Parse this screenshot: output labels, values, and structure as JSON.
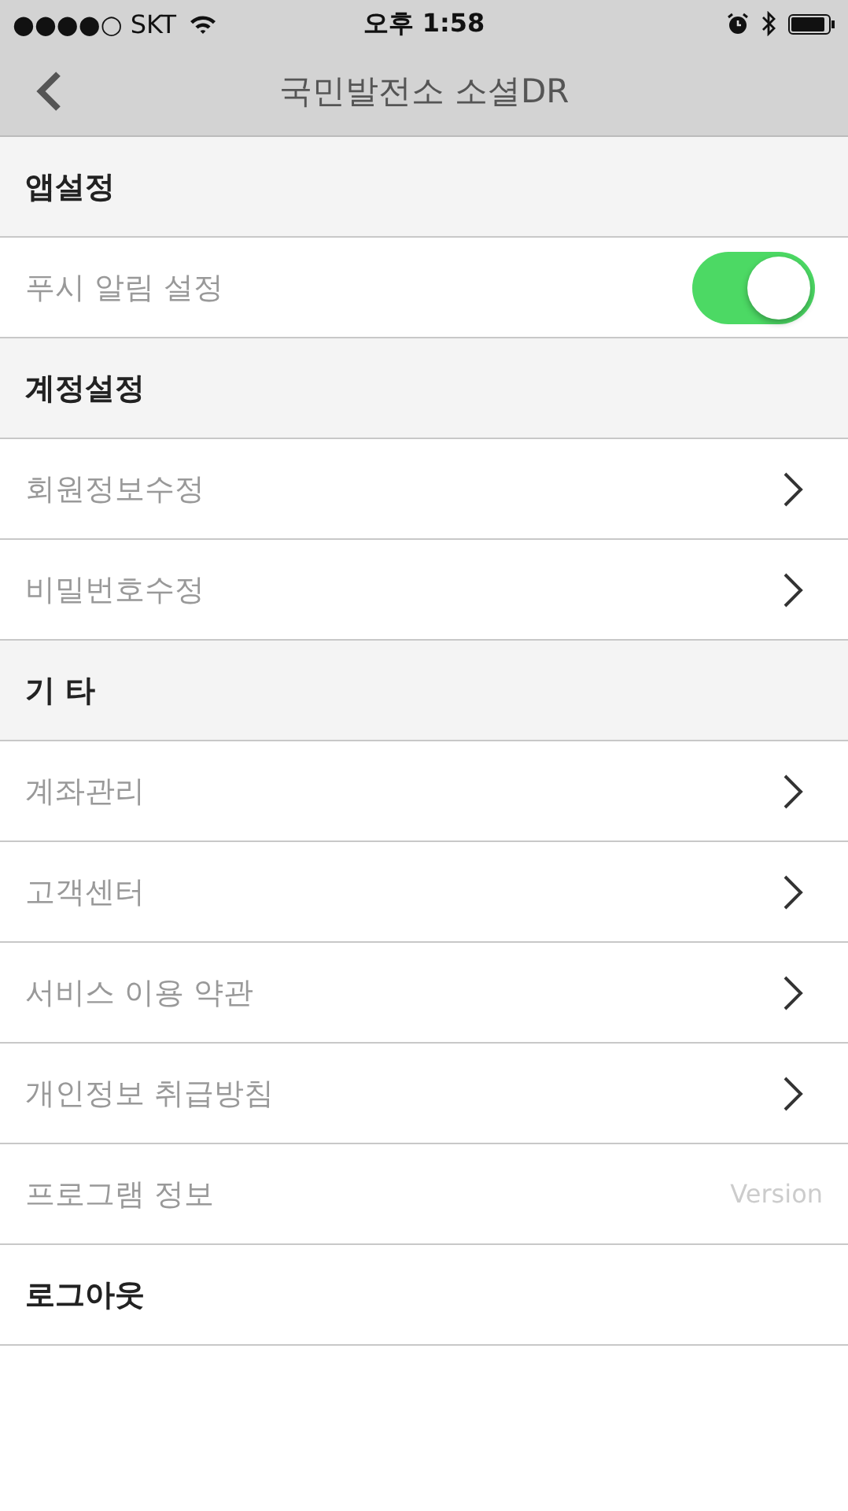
{
  "status_bar": {
    "carrier": "●●●●○ SKT",
    "time": "오후 1:58"
  },
  "nav": {
    "title": "국민발전소 소셜DR"
  },
  "rows": [
    {
      "kind": "section",
      "label": "앱설정"
    },
    {
      "kind": "toggle",
      "label": "푸시 알림 설정",
      "on": true
    },
    {
      "kind": "section",
      "label": "계정설정"
    },
    {
      "kind": "link",
      "label": "회원정보수정"
    },
    {
      "kind": "link",
      "label": "비밀번호수정"
    },
    {
      "kind": "section",
      "label": "기 타"
    },
    {
      "kind": "link",
      "label": "계좌관리"
    },
    {
      "kind": "link",
      "label": "고객센터"
    },
    {
      "kind": "link",
      "label": "서비스 이용 약관"
    },
    {
      "kind": "link",
      "label": "개인정보 취급방침"
    },
    {
      "kind": "info",
      "label": "프로그램 정보",
      "value": "Version"
    },
    {
      "kind": "action",
      "label": "로그아웃"
    }
  ]
}
